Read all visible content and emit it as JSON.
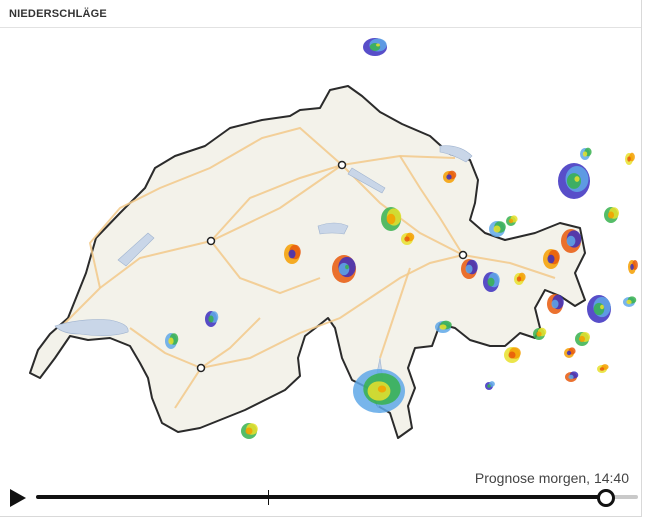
{
  "header": {
    "title": "NIEDERSCHLÄGE"
  },
  "map": {
    "land_color": "#f3f2ea",
    "border_color": "#2b2b2b",
    "road_color": "#f2c98a",
    "lake_color": "#c9d6e8",
    "precip_palette": [
      "#3b2fbf",
      "#5fa8e8",
      "#37b24d",
      "#e7e02b",
      "#f59f00",
      "#e8590c"
    ],
    "cities": [
      "city-1",
      "city-2",
      "city-3",
      "city-4"
    ]
  },
  "player": {
    "forecast_label": "Prognose morgen, 14:40",
    "progress": 0.945,
    "now_position": 0.385,
    "play_icon": "play-icon"
  }
}
